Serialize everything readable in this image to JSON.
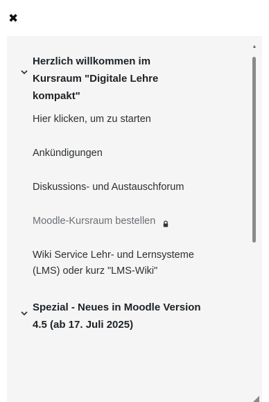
{
  "close": {
    "icon": "close-icon"
  },
  "sections": [
    {
      "title": "Herzlich willkommen im Kursraum \"Digitale Lehre kompakt\"",
      "expanded": true,
      "icon": "chevron-down-icon",
      "items": [
        {
          "label": "Hier klicken, um zu starten"
        },
        {
          "label": "Ankündigungen"
        },
        {
          "label": "Diskussions- und Austauschforum"
        },
        {
          "label": "Moodle-Kursraum bestellen",
          "restricted": true,
          "icon": "lock-icon"
        },
        {
          "label": "Wiki Service Lehr- und Lernsysteme (LMS) oder kurz \"LMS-Wiki\""
        }
      ]
    },
    {
      "title": "Spezial - Neues in Moodle Version 4.5 (ab 17. Juli 2025)",
      "expanded": false,
      "icon": "chevron-down-icon"
    }
  ],
  "colors": {
    "drawer_background": "#f5f5f5",
    "text": "#1d2125",
    "restricted_text": "#6b6f73",
    "scrollbar_thumb": "#8a8a8a"
  }
}
